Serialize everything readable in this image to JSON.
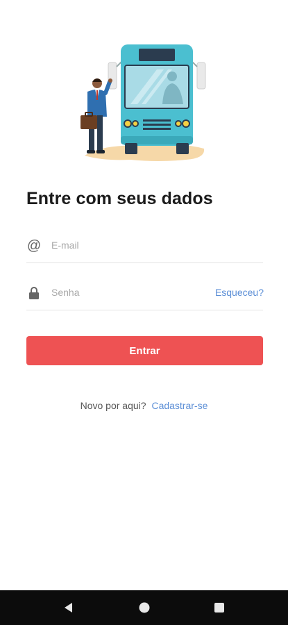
{
  "login": {
    "title": "Entre com seus dados",
    "email": {
      "icon": "at-sign-icon",
      "placeholder": "E-mail",
      "value": ""
    },
    "password": {
      "icon": "lock-icon",
      "placeholder": "Senha",
      "value": "",
      "forgot_label": "Esqueceu?"
    },
    "submit_label": "Entrar",
    "signup_prompt": "Novo por aqui?",
    "signup_link": "Cadastrar-se"
  },
  "illustration": {
    "name": "bus-passenger-illustration"
  },
  "nav_bar": {
    "back_icon": "back-triangle-icon",
    "home_icon": "home-circle-icon",
    "recents_icon": "recents-square-icon"
  },
  "colors": {
    "primary_button": "#ee5253",
    "link": "#5b8ed6",
    "bus_body": "#4bbfd0",
    "nav_bar": "#0c0c0c"
  }
}
